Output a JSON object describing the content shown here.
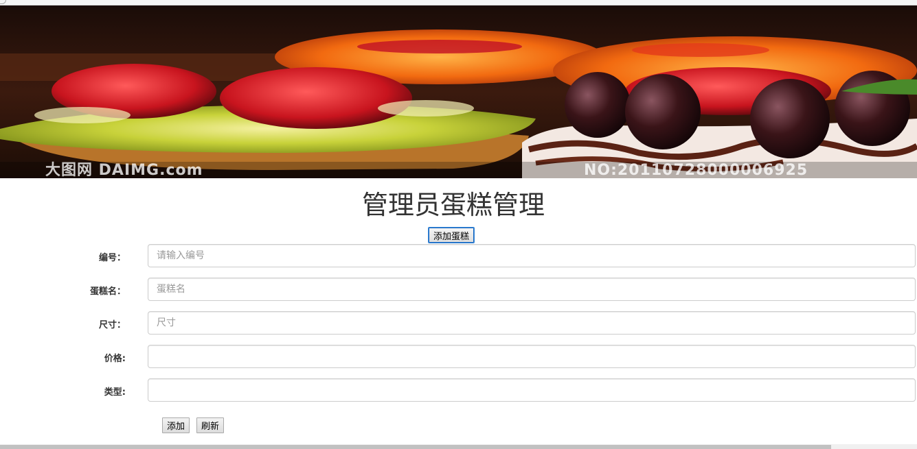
{
  "banner": {
    "watermark_left": "大图网 DAIMG.com",
    "watermark_right": "NO:20110728000006925"
  },
  "page": {
    "title": "管理员蛋糕管理",
    "add_cake_label": "添加蛋糕"
  },
  "form": {
    "fields": [
      {
        "label": "编号：",
        "placeholder": "请输入编号",
        "value": ""
      },
      {
        "label": "蛋糕名：",
        "placeholder": "蛋糕名",
        "value": ""
      },
      {
        "label": "尺寸：",
        "placeholder": "尺寸",
        "value": ""
      },
      {
        "label": "价格:",
        "placeholder": "",
        "value": ""
      },
      {
        "label": "类型:",
        "placeholder": "",
        "value": ""
      }
    ],
    "add_label": "添加",
    "refresh_label": "刷新"
  },
  "colors": {
    "focus_border": "#1565c0"
  }
}
